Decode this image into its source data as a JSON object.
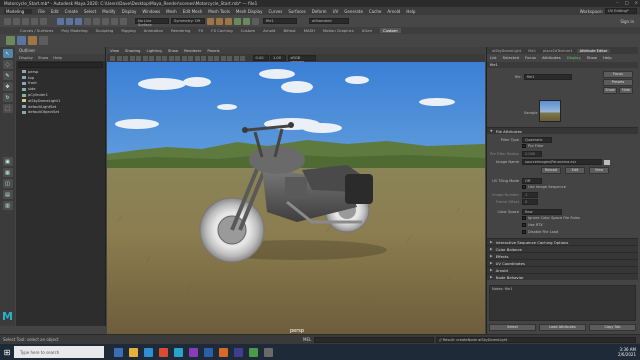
{
  "window": {
    "title": "Motorcycle_Start.mb* - Autodesk Maya 2020: C:\\Users\\Dave\\Desktop\\Maya_Render\\scenes\\Motorcycle_Start.mb* --- file1",
    "controls": [
      "–",
      "□",
      "×"
    ]
  },
  "menubar": {
    "mode": "Modeling",
    "items": [
      "File",
      "Edit",
      "Create",
      "Select",
      "Modify",
      "Display",
      "Windows",
      "Mesh",
      "Edit Mesh",
      "Mesh Tools",
      "Mesh Display",
      "Curves",
      "Surfaces",
      "Deform",
      "UV",
      "Generate",
      "Cache",
      "Arnold",
      "Help"
    ]
  },
  "statusline": {
    "workspace_label": "Workspace:",
    "workspace": "UV Editing*",
    "no_live_surface": "No Live Surface",
    "symmetry": "Symmetry: Off",
    "selected_node": "file1",
    "render_setting": "aiStandard",
    "sign_in": "Sign in"
  },
  "shelf_tabs": [
    "Curves / Surfaces",
    "Poly Modeling",
    "Sculpting",
    "Rigging",
    "Animation",
    "Rendering",
    "FX",
    "FX Caching",
    "Custom",
    "Arnold",
    "Bifrost",
    "MASH",
    "Motion Graphics",
    "XGen",
    "Custom"
  ],
  "shelf_active_tab": "Custom",
  "outliner": {
    "title": "Outliner",
    "menu": [
      "Display",
      "Show",
      "Help"
    ],
    "items": [
      {
        "label": "persp",
        "icon": "camera-icon"
      },
      {
        "label": "top",
        "icon": "camera-icon"
      },
      {
        "label": "front",
        "icon": "camera-icon"
      },
      {
        "label": "side",
        "icon": "camera-icon"
      },
      {
        "label": "pCylinder1",
        "icon": "mesh-icon"
      },
      {
        "label": "aiSkyDomeLight1",
        "icon": "light-icon"
      },
      {
        "label": "defaultLightSet",
        "icon": "set-icon"
      },
      {
        "label": "defaultObjectSet",
        "icon": "set-icon"
      }
    ]
  },
  "viewport": {
    "menu": [
      "View",
      "Shading",
      "Lighting",
      "Show",
      "Renderer",
      "Panels"
    ],
    "gamma": "0.00",
    "exposure": "1.00",
    "color_space": "sRGB gamma",
    "camera_label": "persp"
  },
  "attribute_editor": {
    "tabs": [
      "List",
      "Selected",
      "Focus",
      "Attributes",
      "Display",
      "Show",
      "Help"
    ],
    "node_tabs": [
      "aiSkyDomeLight",
      "file1",
      "place2dTexture1",
      "Attribute Editor"
    ],
    "active_node_tab": "Attribute Editor",
    "file_label": "file:",
    "file_value": "file1",
    "focus_button": "Focus",
    "presets_button": "Presets",
    "show_button": "Show",
    "hide_button": "Hide",
    "sample_label": "Sample",
    "sections": {
      "file_attributes": "File Attributes",
      "interactive_sequence": "Interactive Sequence Caching Options",
      "color_balance": "Color Balance",
      "effects": "Effects",
      "uv_coordinates": "UV Coordinates",
      "arnold": "Arnold",
      "node_behavior": "Node Behavior"
    },
    "rows": [
      {
        "key": "Filter Type",
        "value": "Quadratic"
      },
      {
        "key": "",
        "value": "Pre Filter"
      },
      {
        "key": "Pre Filter Radius",
        "value": "2.000"
      },
      {
        "key": "Image Name",
        "value": "sourceimages\\Panorama.exr"
      },
      {
        "key": "",
        "value": "Reload / Edit / View"
      },
      {
        "key": "UV Tiling Mode",
        "value": "Off"
      },
      {
        "key": "",
        "value": "Use Image Sequence"
      },
      {
        "key": "Image Number",
        "value": "1"
      },
      {
        "key": "Frame Offset",
        "value": "0"
      },
      {
        "key": "Color Space",
        "value": "Raw"
      },
      {
        "key": "",
        "value": "Ignore Color Space File Rules"
      },
      {
        "key": "",
        "value": "Use RTX"
      },
      {
        "key": "",
        "value": "Disable File Load"
      }
    ],
    "reload": "Reload",
    "edit": "Edit",
    "view": "View",
    "notes_label": "Notes: file1",
    "footer": {
      "select": "Select",
      "load_attributes": "Load Attributes",
      "copy_tab": "Copy Tab"
    }
  },
  "commandline": {
    "lang": "MEL",
    "result": "// Result: createNode aiSkyDomeLight",
    "help": "Select Tool: select an object"
  },
  "taskbar": {
    "search_placeholder": "Type here to search",
    "time": "3:36 AM",
    "date": "2/6/2021"
  }
}
